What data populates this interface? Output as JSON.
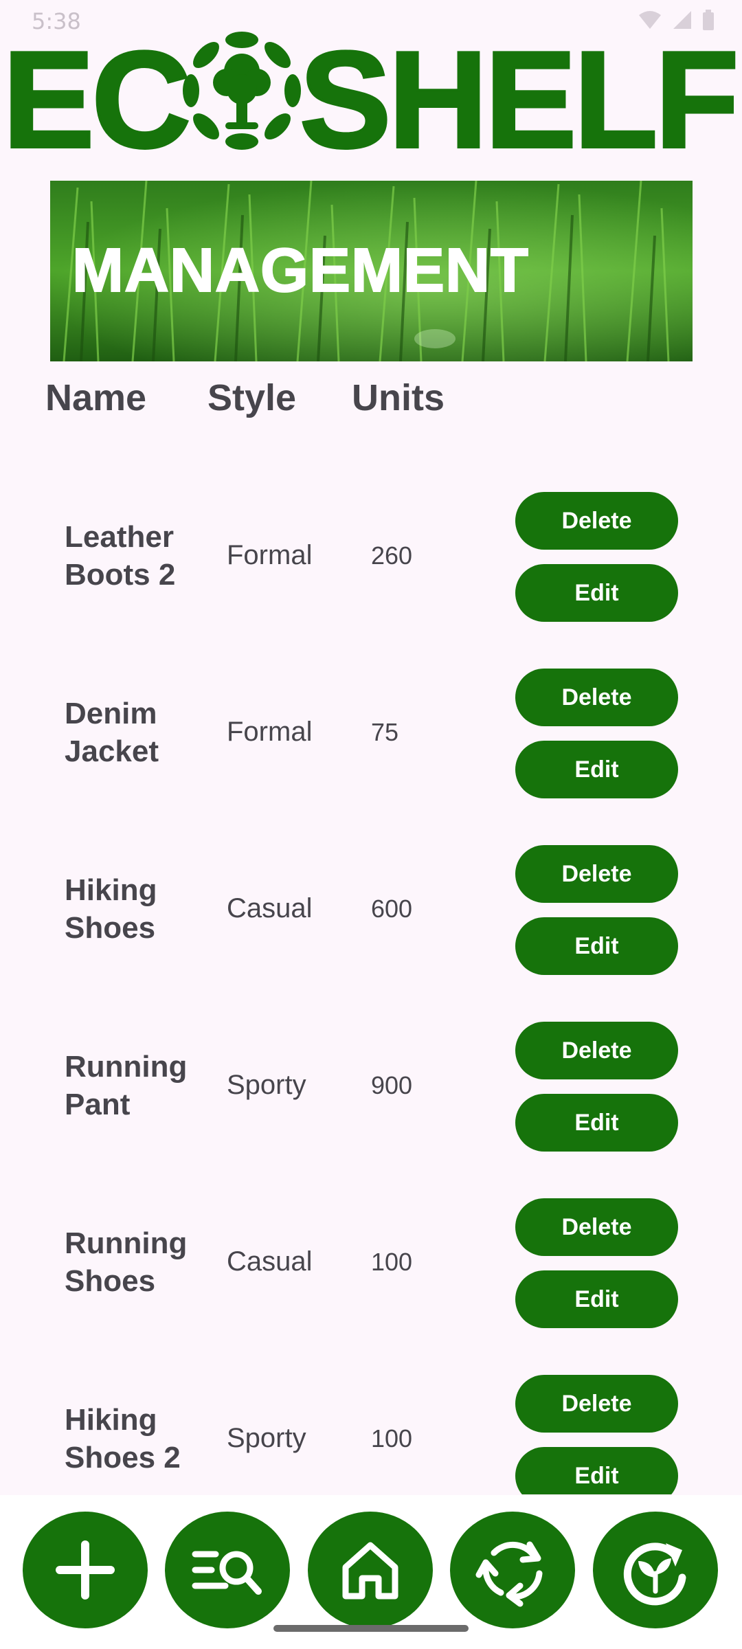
{
  "status_bar": {
    "time": "5:38"
  },
  "logo": {
    "left_text": "EC",
    "right_text": "SHELF"
  },
  "banner": {
    "title": "MANAGEMENT"
  },
  "columns": {
    "name": "Name",
    "style": "Style",
    "units": "Units"
  },
  "products": [
    {
      "name": "Leather Boots 2",
      "style": "Formal",
      "units": "260"
    },
    {
      "name": "Denim Jacket",
      "style": "Formal",
      "units": "75"
    },
    {
      "name": "Hiking Shoes",
      "style": "Casual",
      "units": "600"
    },
    {
      "name": "Running Pant",
      "style": "Sporty",
      "units": "900"
    },
    {
      "name": "Running Shoes",
      "style": "Casual",
      "units": "100"
    },
    {
      "name": "Hiking Shoes 2",
      "style": "Sporty",
      "units": "100"
    }
  ],
  "buttons": {
    "delete": "Delete",
    "edit": "Edit"
  },
  "nav": {
    "items": [
      {
        "icon": "plus-icon"
      },
      {
        "icon": "list-search-icon"
      },
      {
        "icon": "home-icon"
      },
      {
        "icon": "refresh-arrows-icon"
      },
      {
        "icon": "recycle-leaf-icon"
      }
    ]
  },
  "colors": {
    "brand": "#16730b",
    "background": "#fdf6fc",
    "text": "#47454c"
  }
}
